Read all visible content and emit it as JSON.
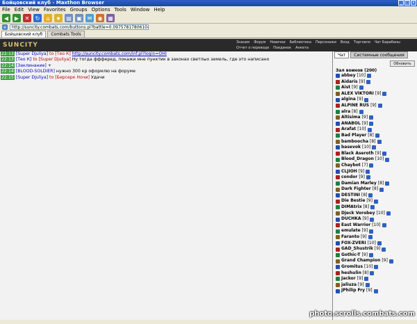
{
  "window": {
    "title": "Бойцовский клуб - Maxthon Browser"
  },
  "menu": [
    "File",
    "Edit",
    "View",
    "Favorites",
    "Groups",
    "Options",
    "Tools",
    "Window",
    "Help"
  ],
  "address": {
    "value": "http://suncity.combats.com/buttons.pl?battle=0.097578178061046"
  },
  "tabs": [
    "Бойцовский клуб",
    "Combats Tools"
  ],
  "header": {
    "logo": "SUNCITY",
    "links": [
      "Знания",
      "Форум",
      "Новички",
      "Библиотека",
      "Персонажи",
      "Вход",
      "Торговля",
      "Чат Барабаны",
      "Отчет о переводе",
      "Поединок",
      "Анкета"
    ]
  },
  "chat_lines": [
    {
      "ts": "22:13",
      "nick": "[Super Djuliya]",
      "to": "to [Тео К]",
      "text": "http://suncity.combats.com/inf.pl?login=OHI"
    },
    {
      "ts": "22:13",
      "nick": "[Тео К]",
      "to": "to [Super Djuliya]",
      "text": "Ну тогда ффферед, покажи мне пунктик в законах светлых земель, где это написано"
    },
    {
      "ts": "22:14",
      "nick": "[Заклинание]",
      "to": "",
      "text": "+"
    },
    {
      "ts": "22:14",
      "nick": "[BLOOD-SOLDIER]",
      "to": "",
      "text": "нужно 300 кр оформлю на форуме"
    },
    {
      "ts": "22:15",
      "nick": "[Super Djuliya]",
      "to": "to [Берсерк Ночи]",
      "text": "Удачи"
    }
  ],
  "chat_tabs": [
    "Чат",
    "Системные сообщения"
  ],
  "refresh_label": "Обновить",
  "room": {
    "title": "Зал воинов (200)"
  },
  "players": [
    {
      "name": "abbey",
      "level": "[10]"
    },
    {
      "name": "Aidaris",
      "level": "[9]"
    },
    {
      "name": "Aist",
      "level": "[9]"
    },
    {
      "name": "ALEX VIKTORI",
      "level": "[9]"
    },
    {
      "name": "algina",
      "level": "[9]"
    },
    {
      "name": "ALPINE RUS",
      "level": "[9]"
    },
    {
      "name": "alra",
      "level": "[8]"
    },
    {
      "name": "Altisima",
      "level": "[9]"
    },
    {
      "name": "ANABOL",
      "level": "[9]"
    },
    {
      "name": "Arafat",
      "level": "[10]"
    },
    {
      "name": "Bad Player",
      "level": "[8]"
    },
    {
      "name": "bamboocha",
      "level": "[8]"
    },
    {
      "name": "basevok",
      "level": "[10]"
    },
    {
      "name": "Black Aseroth",
      "level": "[9]"
    },
    {
      "name": "Blood_Dragon",
      "level": "[10]"
    },
    {
      "name": "Chaybot",
      "level": "[7]"
    },
    {
      "name": "CLJIOH",
      "level": "[9]"
    },
    {
      "name": "condor",
      "level": "[9]"
    },
    {
      "name": "Damian Marley",
      "level": "[8]"
    },
    {
      "name": "Dark Fighter",
      "level": "[8]"
    },
    {
      "name": "DESTINI",
      "level": "[8]"
    },
    {
      "name": "Die Bestie",
      "level": "[9]"
    },
    {
      "name": "DIMAtrix",
      "level": "[8]"
    },
    {
      "name": "Djeck Vorobey",
      "level": "[10]"
    },
    {
      "name": "DUCHKA",
      "level": "[9]"
    },
    {
      "name": "East Warrior",
      "level": "[10]"
    },
    {
      "name": "emulate",
      "level": "[9]"
    },
    {
      "name": "Faranto",
      "level": "[9]"
    },
    {
      "name": "FOX-ZVERI",
      "level": "[10]"
    },
    {
      "name": "GAD_Shustrik",
      "level": "[9]"
    },
    {
      "name": "Gothic-T",
      "level": "[9]"
    },
    {
      "name": "Grand Champion",
      "level": "[9]"
    },
    {
      "name": "Gromitus",
      "level": "[10]"
    },
    {
      "name": "heshulin",
      "level": "[8]"
    },
    {
      "name": "Jackor",
      "level": "[9]"
    },
    {
      "name": "jaliuza",
      "level": "[9]"
    },
    {
      "name": "JPhilip Fry",
      "level": "[9]"
    }
  ],
  "watermark": "photo.scrolls.combats.com",
  "colors": {
    "timestamp_bg": "#3aa040",
    "nick": "#0000c0",
    "private": "#c00000",
    "header_bg": "#2a2a2a",
    "title_bg": "#1a46a8"
  }
}
